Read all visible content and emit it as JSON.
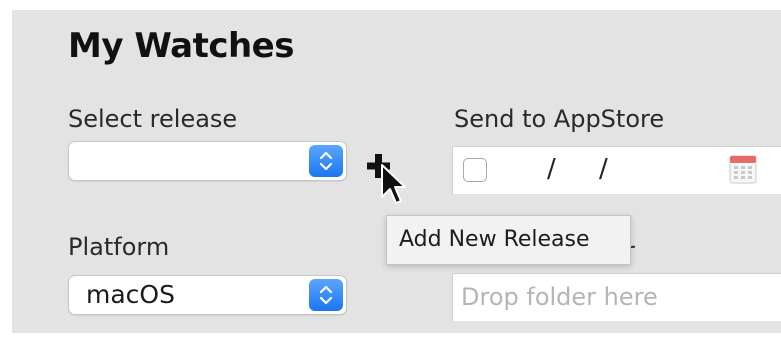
{
  "page": {
    "title": "My Watches"
  },
  "form": {
    "release": {
      "label": "Select release",
      "value": ""
    },
    "add_release_tooltip": "Add New Release",
    "send_to_appstore": {
      "label": "Send to AppStore",
      "checked": false,
      "date_separator": "/"
    },
    "platform": {
      "label": "Platform",
      "value": "macOS"
    },
    "folder": {
      "label_tail": "r",
      "placeholder": "Drop folder here"
    }
  },
  "icons": {
    "stepper": "chevron-up-down-icon",
    "add": "plus-icon",
    "calendar": "calendar-icon",
    "cursor": "arrow-cursor-icon"
  },
  "colors": {
    "panel_bg": "#e3e3e3",
    "accent": "#1c76f0"
  }
}
